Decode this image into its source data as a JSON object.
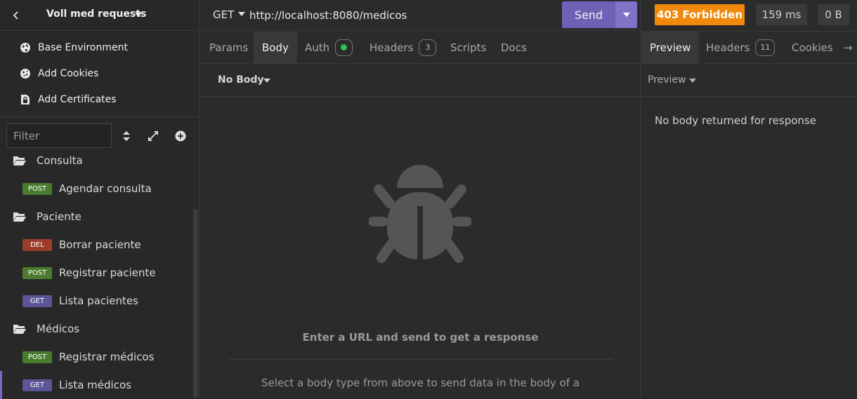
{
  "sidebar": {
    "back_icon": "chevron-left-icon",
    "collection_title": "Voll med requests",
    "menu": [
      {
        "label": "Base Environment",
        "icon": "globe-icon"
      },
      {
        "label": "Add Cookies",
        "icon": "cookie-icon"
      },
      {
        "label": "Add Certificates",
        "icon": "certificate-icon"
      }
    ],
    "filter_placeholder": "Filter",
    "tree": [
      {
        "type": "folder",
        "label": "Consulta"
      },
      {
        "type": "request",
        "method": "POST",
        "label": "Agendar consulta"
      },
      {
        "type": "folder",
        "label": "Paciente"
      },
      {
        "type": "request",
        "method": "DEL",
        "label": "Borrar paciente"
      },
      {
        "type": "request",
        "method": "POST",
        "label": "Registrar paciente"
      },
      {
        "type": "request",
        "method": "GET",
        "label": "Lista pacientes"
      },
      {
        "type": "folder",
        "label": "Médicos"
      },
      {
        "type": "request",
        "method": "POST",
        "label": "Registrar médicos"
      },
      {
        "type": "request",
        "method": "GET",
        "label": "Lista médicos",
        "active": true
      }
    ]
  },
  "request": {
    "method": "GET",
    "url": "http://localhost:8080/medicos",
    "send_label": "Send",
    "tabs": {
      "params": "Params",
      "body": "Body",
      "auth": "Auth",
      "headers": "Headers",
      "headers_count": "3",
      "scripts": "Scripts",
      "docs": "Docs"
    },
    "body_type": "No Body",
    "empty_title": "Enter a URL and send to get a response",
    "empty_desc": "Select a body type from above to send data in the body of a"
  },
  "response": {
    "status": "403 Forbidden",
    "time": "159 ms",
    "size": "0 B",
    "tabs": {
      "preview": "Preview",
      "headers": "Headers",
      "headers_count": "11",
      "cookies": "Cookies",
      "more": "→"
    },
    "preview_mode": "Preview",
    "empty_text": "No body returned for response"
  },
  "colors": {
    "accent": "#7161b6",
    "status_forbidden": "#f0890c",
    "post": "#4a7b2e",
    "delete": "#9b3d2a",
    "get": "#5c5697"
  }
}
